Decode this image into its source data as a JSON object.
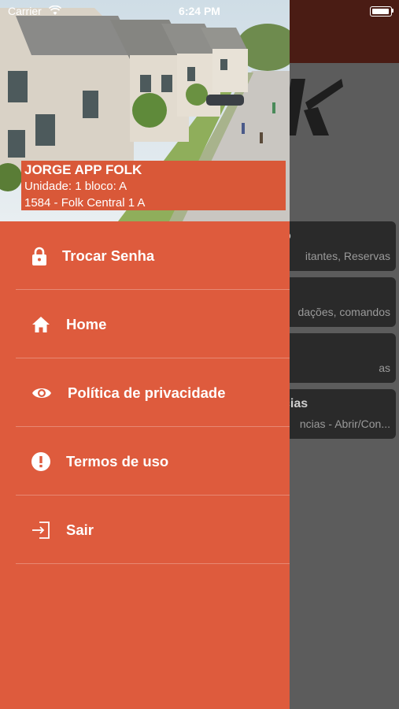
{
  "status_bar": {
    "carrier": "Carrier",
    "time": "6:24 PM"
  },
  "drawer": {
    "user": {
      "name": "JORGE APP FOLK",
      "unit": "Unidade: 1 bloco: A",
      "address": "1584 - Folk Central 1 A"
    },
    "menu": [
      {
        "label": "Trocar Senha",
        "icon": "lock-icon"
      },
      {
        "label": "Home",
        "icon": "home-icon"
      },
      {
        "label": "Política de privacidade",
        "icon": "eye-icon"
      },
      {
        "label": "Termos de uso",
        "icon": "alert-icon"
      },
      {
        "label": "Sair",
        "icon": "logout-icon"
      }
    ]
  },
  "background": {
    "cards": [
      {
        "title": "o",
        "subtitle": "itantes, Reservas"
      },
      {
        "title": "",
        "subtitle": "dações, comandos"
      },
      {
        "title": "",
        "subtitle": "as"
      },
      {
        "title": "cias",
        "subtitle": "ncias - Abrir/Con..."
      }
    ]
  },
  "colors": {
    "drawer_bg": "#de5b3d",
    "overlay": "#5c5c5c",
    "topbar": "#4a1c14"
  }
}
